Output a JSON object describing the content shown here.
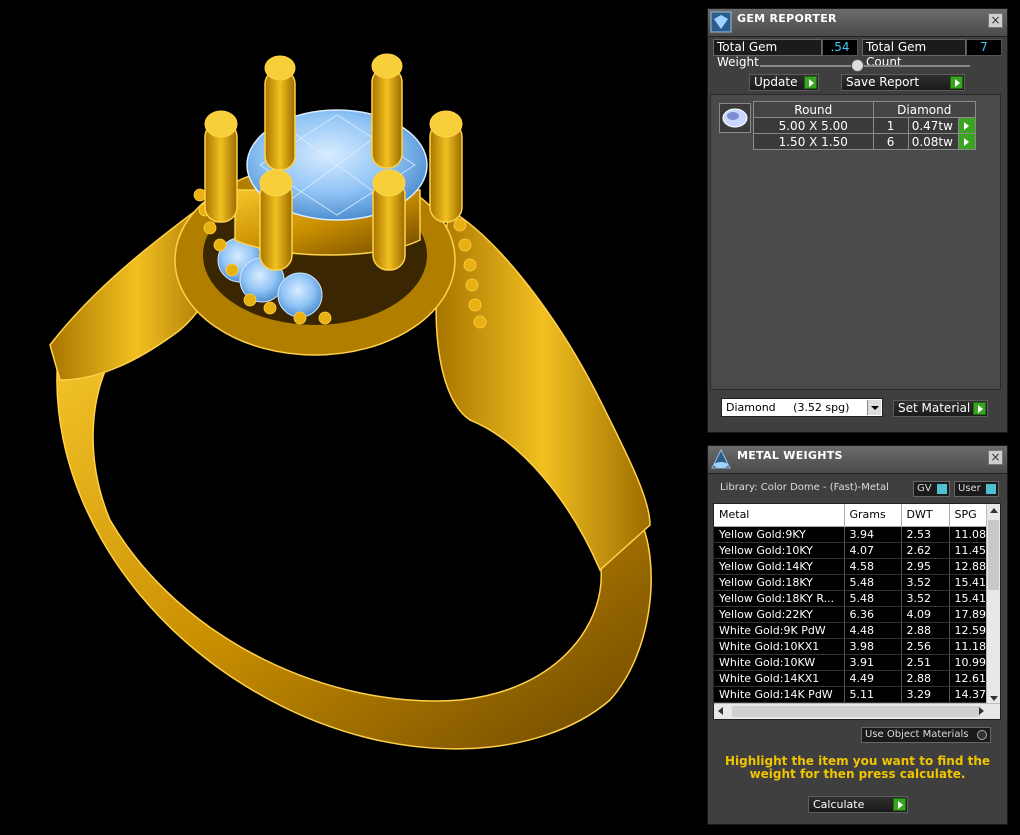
{
  "gem_reporter": {
    "title": "GEM REPORTER",
    "close": "×",
    "total_weight_label": "Total Gem Weight",
    "total_weight_value": ".54",
    "total_count_label": "Total Gem Count",
    "total_count_value": "7",
    "update_label": "Update",
    "save_label": "Save Report",
    "table": {
      "headers": [
        "Round",
        "Diamond"
      ],
      "rows": [
        {
          "size": "5.00 X 5.00",
          "qty": "1",
          "tw": "0.47tw"
        },
        {
          "size": "1.50 X 1.50",
          "qty": "6",
          "tw": "0.08tw"
        }
      ]
    },
    "material_select": "Diamond     (3.52 spg)",
    "set_material_label": "Set Material"
  },
  "metal_weights": {
    "title": "METAL WEIGHTS",
    "close": "×",
    "library": "Library: Color Dome - (Fast)-Metal",
    "gv_label": "GV",
    "user_label": "User",
    "columns": [
      "Metal",
      "Grams",
      "DWT",
      "SPG"
    ],
    "rows": [
      [
        "Yellow Gold:9KY",
        "3.94",
        "2.53",
        "11.08"
      ],
      [
        "Yellow Gold:10KY",
        "4.07",
        "2.62",
        "11.45"
      ],
      [
        "Yellow Gold:14KY",
        "4.58",
        "2.95",
        "12.88"
      ],
      [
        "Yellow Gold:18KY",
        "5.48",
        "3.52",
        "15.41"
      ],
      [
        "Yellow Gold:18KY R...",
        "5.48",
        "3.52",
        "15.41"
      ],
      [
        "Yellow Gold:22KY",
        "6.36",
        "4.09",
        "17.89"
      ],
      [
        "White Gold:9K PdW",
        "4.48",
        "2.88",
        "12.59"
      ],
      [
        "White Gold:10KX1",
        "3.98",
        "2.56",
        "11.18"
      ],
      [
        "White Gold:10KW",
        "3.91",
        "2.51",
        "10.99"
      ],
      [
        "White Gold:14KX1",
        "4.49",
        "2.88",
        "12.61"
      ],
      [
        "White Gold:14K PdW",
        "5.11",
        "3.29",
        "14.37"
      ]
    ],
    "use_object_materials": "Use Object Materials",
    "hint": "Highlight the item you want to find the weight for then press calculate.",
    "calculate_label": "Calculate"
  },
  "colors": {
    "gold": "#e0a300",
    "gem": "#8fc3f5",
    "panel": "#3f3f3f",
    "accent_green": "#3aa321",
    "value_cyan": "#40c9f0",
    "hint_yellow": "#f0c400"
  }
}
